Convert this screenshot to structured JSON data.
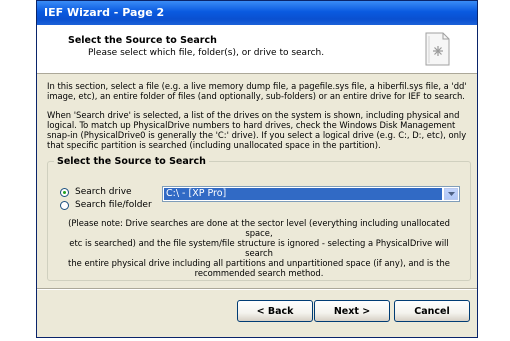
{
  "window": {
    "title": "IEF Wizard - Page 2"
  },
  "header": {
    "title": "Select the Source to Search",
    "subtitle": "Please select which file, folder(s), or drive to search.",
    "icon": "wizard-page-icon"
  },
  "body": {
    "para1_line1": "In this section, select a file (e.g. a live memory dump file, a pagefile.sys file, a hiberfil.sys file, a 'dd'",
    "para1_line2": "image, etc), an entire folder of files (and optionally, sub-folders) or an entire drive for IEF to search.",
    "para2_line1": "When 'Search drive' is selected, a list of the drives on the system is shown, including physical and",
    "para2_line2": "logical. To match up PhysicalDrive numbers to hard drives, check the Windows Disk Management",
    "para2_line3": "snap-in (PhysicalDrive0 is generally the 'C:' drive). If you select a logical drive (e.g. C:, D:, etc), only",
    "para2_line4": "that specific partition is searched (including unallocated space in the partition)."
  },
  "source_group": {
    "legend": "Select the Source to Search",
    "options": [
      {
        "label": "Search drive",
        "checked": true
      },
      {
        "label": "Search file/folder",
        "checked": false
      }
    ],
    "drive_select": {
      "value": "C:\\  -  [XP Pro]"
    },
    "note_line1": "(Please note: Drive searches are done at the sector level (everything including unallocated space,",
    "note_line2": "etc is searched) and the file system/file structure is ignored - selecting a PhysicalDrive will search",
    "note_line3": "the entire physical drive including all partitions and unpartitioned space (if any), and is the",
    "note_line4": "recommended search method."
  },
  "buttons": {
    "back": "< Back",
    "next": "Next >",
    "cancel": "Cancel"
  },
  "colors": {
    "titlebar": "#0a5ae0",
    "dialog_bg": "#ece9d8",
    "selection": "#316ac5"
  }
}
